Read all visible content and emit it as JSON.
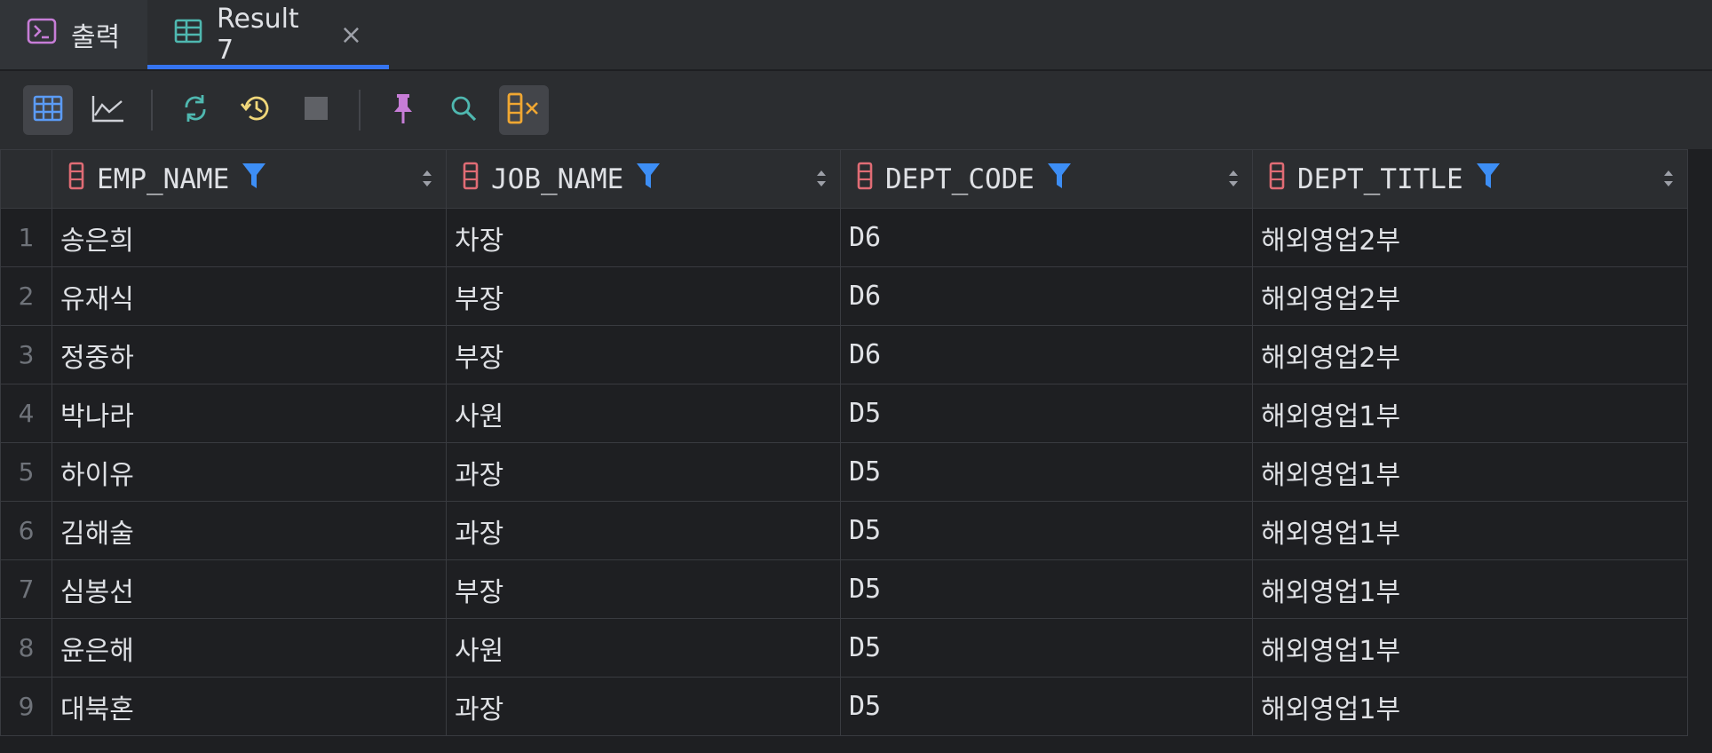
{
  "tabs": [
    {
      "label": "출력",
      "icon": "console-icon"
    },
    {
      "label": "Result 7",
      "icon": "table-icon",
      "close": "×"
    }
  ],
  "toolbar": {
    "buttons": [
      "table-view-icon",
      "chart-view-icon",
      "refresh-icon",
      "history-icon",
      "stop-icon",
      "pin-icon",
      "search-icon",
      "columns-icon"
    ]
  },
  "grid": {
    "columns": [
      "EMP_NAME",
      "JOB_NAME",
      "DEPT_CODE",
      "DEPT_TITLE"
    ],
    "rows": [
      {
        "num": "1",
        "cells": [
          "송은희",
          "차장",
          "D6",
          "해외영업2부"
        ]
      },
      {
        "num": "2",
        "cells": [
          "유재식",
          "부장",
          "D6",
          "해외영업2부"
        ]
      },
      {
        "num": "3",
        "cells": [
          "정중하",
          "부장",
          "D6",
          "해외영업2부"
        ]
      },
      {
        "num": "4",
        "cells": [
          "박나라",
          "사원",
          "D5",
          "해외영업1부"
        ]
      },
      {
        "num": "5",
        "cells": [
          "하이유",
          "과장",
          "D5",
          "해외영업1부"
        ]
      },
      {
        "num": "6",
        "cells": [
          "김해술",
          "과장",
          "D5",
          "해외영업1부"
        ]
      },
      {
        "num": "7",
        "cells": [
          "심봉선",
          "부장",
          "D5",
          "해외영업1부"
        ]
      },
      {
        "num": "8",
        "cells": [
          "윤은해",
          "사원",
          "D5",
          "해외영업1부"
        ]
      },
      {
        "num": "9",
        "cells": [
          "대북혼",
          "과장",
          "D5",
          "해외영업1부"
        ]
      }
    ]
  },
  "colors": {
    "accent": "#3574f0",
    "filter": "#3d8ef5",
    "column_icon": "#e06c75",
    "background": "#1e1f22",
    "panel": "#2b2d30"
  }
}
